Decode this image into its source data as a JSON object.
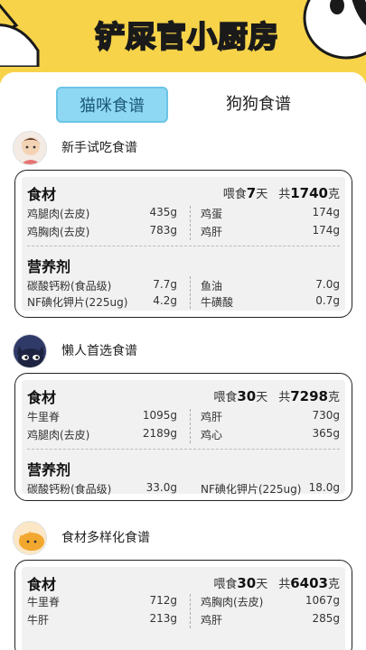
{
  "banner": {
    "title": "铲屎官小厨房"
  },
  "tabs": [
    {
      "label": "猫咪食谱"
    },
    {
      "label": "狗狗食谱"
    }
  ],
  "sections": [
    {
      "title": "新手试吃食谱",
      "feed_prefix": "喂食",
      "days": "7",
      "days_unit": "天",
      "total_prefix": "共",
      "total": "1740",
      "total_unit": "克",
      "ingredients_label": "食材",
      "ingredients": [
        {
          "name": "鸡腿肉(去皮)",
          "value": "435g"
        },
        {
          "name": "鸡蛋",
          "value": "174g"
        },
        {
          "name": "鸡胸肉(去皮)",
          "value": "783g"
        },
        {
          "name": "鸡肝",
          "value": "174g"
        }
      ],
      "nutrients_label": "营养剂",
      "nutrients": [
        {
          "name": "碳酸钙粉(食品级)",
          "value": "7.7g"
        },
        {
          "name": "鱼油",
          "value": "7.0g"
        },
        {
          "name": "NF碘化钾片(225ug)",
          "value": "4.2g"
        },
        {
          "name": "牛磺酸",
          "value": "0.7g"
        }
      ]
    },
    {
      "title": "懒人首选食谱",
      "feed_prefix": "喂食",
      "days": "30",
      "days_unit": "天",
      "total_prefix": "共",
      "total": "7298",
      "total_unit": "克",
      "ingredients_label": "食材",
      "ingredients": [
        {
          "name": "牛里脊",
          "value": "1095g"
        },
        {
          "name": "鸡肝",
          "value": "730g"
        },
        {
          "name": "鸡腿肉(去皮)",
          "value": "2189g"
        },
        {
          "name": "鸡心",
          "value": "365g"
        }
      ],
      "nutrients_label": "营养剂",
      "nutrients": [
        {
          "name": "碳酸钙粉(食品级)",
          "value": "33.0g"
        },
        {
          "name": "NF碘化钾片(225ug)",
          "value": "18.0g"
        }
      ]
    },
    {
      "title": "食材多样化食谱",
      "feed_prefix": "喂食",
      "days": "30",
      "days_unit": "天",
      "total_prefix": "共",
      "total": "6403",
      "total_unit": "克",
      "ingredients_label": "食材",
      "ingredients": [
        {
          "name": "牛里脊",
          "value": "712g"
        },
        {
          "name": "鸡胸肉(去皮)",
          "value": "1067g"
        },
        {
          "name": "牛肝",
          "value": "213g"
        },
        {
          "name": "鸡肝",
          "value": "285g"
        }
      ]
    }
  ],
  "colors": {
    "banner": "#f7d34a",
    "tab_active": "#8fd8f3",
    "card_inner": "#f1f1f1"
  }
}
